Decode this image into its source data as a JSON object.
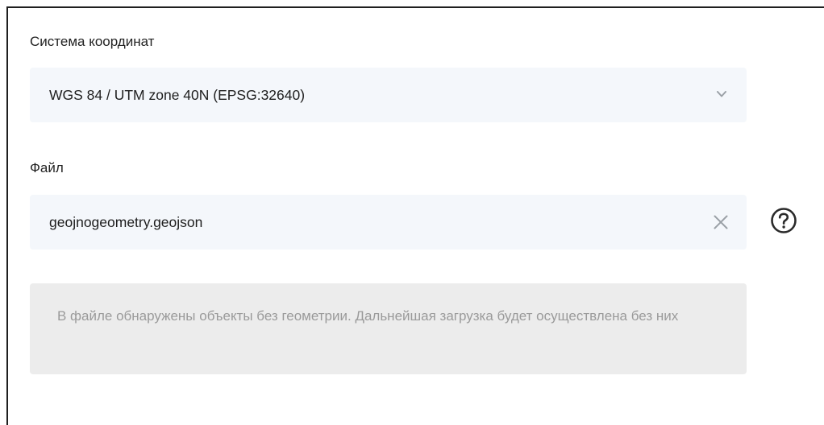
{
  "crs": {
    "label": "Система координат",
    "selected_value": "WGS 84 / UTM zone 40N (EPSG:32640)",
    "icon": "chevron-down-icon"
  },
  "file": {
    "label": "Файл",
    "value": "geojnogeometry.geojson",
    "clear_icon": "close-icon",
    "help_icon": "help-icon"
  },
  "notice": {
    "text": "В файле обнаружены объекты без геометрии. Дальнейшая загрузка будет осуществлена без них"
  },
  "colors": {
    "field_bg": "#f4f7fb",
    "notice_bg": "#ececec",
    "notice_text": "#9a9a9a",
    "icon": "#9aa0a6"
  }
}
